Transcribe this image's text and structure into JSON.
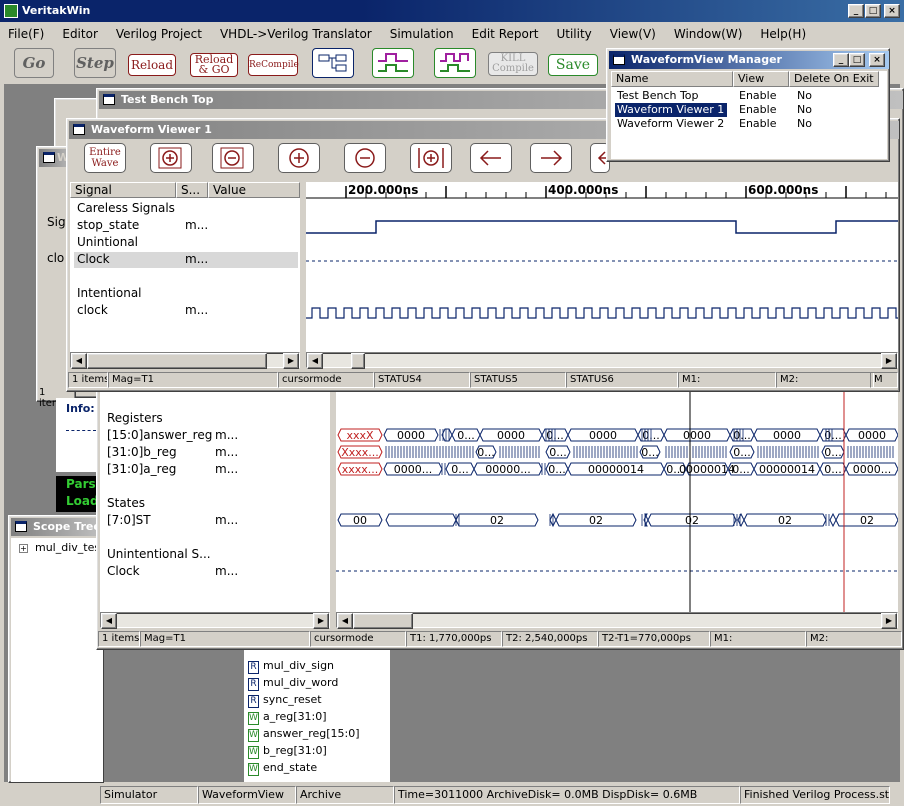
{
  "app": {
    "title": "VeritakWin",
    "menu": [
      "File(F)",
      "Editor",
      "Verilog Project",
      "VHDL->Verilog Translator",
      "Simulation",
      "Edit Report",
      "Utility",
      "View(V)",
      "Window(W)",
      "Help(H)"
    ],
    "toolbar": {
      "go": "Go",
      "step": "Step",
      "reload": "Reload",
      "reload_go": "Reload & GO",
      "recompile": "ReCompile",
      "kill": "KILL Compile",
      "save": "Save"
    }
  },
  "tbtop": {
    "title": "Test Bench Top"
  },
  "wv1": {
    "title": "Waveform Viewer 1",
    "entire_wave": "Entire Wave",
    "cols": [
      "Signal",
      "S...",
      "Value"
    ],
    "rows": [
      {
        "signal": "Careless Signals",
        "val": ""
      },
      {
        "signal": "stop_state",
        "val": "m..."
      },
      {
        "signal": "Unintional",
        "val": ""
      },
      {
        "signal": "Clock",
        "val": "m..."
      },
      {
        "signal": "",
        "val": ""
      },
      {
        "signal": "Intentional",
        "val": ""
      },
      {
        "signal": "clock",
        "val": "m..."
      }
    ],
    "ticks": [
      "200.000ns",
      "400.000ns",
      "600.000ns"
    ],
    "status": [
      "1 items.",
      "Mag=T1",
      "cursormode",
      "STATUS4",
      "STATUS5",
      "STATUS6",
      "M1:",
      "M2:",
      "M"
    ]
  },
  "wv2": {
    "rows": [
      {
        "signal": "Registers",
        "val": ""
      },
      {
        "signal": "[15:0]answer_reg",
        "val": "m..."
      },
      {
        "signal": "[31:0]b_reg",
        "val": "m..."
      },
      {
        "signal": "[31:0]a_reg",
        "val": "m..."
      },
      {
        "signal": "",
        "val": ""
      },
      {
        "signal": "States",
        "val": ""
      },
      {
        "signal": "[7:0]ST",
        "val": "m..."
      },
      {
        "signal": "",
        "val": ""
      },
      {
        "signal": "Unintentional S...",
        "val": ""
      },
      {
        "signal": "Clock",
        "val": "m..."
      }
    ],
    "answer_vals": [
      "xxxX",
      "0000",
      "0...",
      "0000",
      "0...",
      "0000",
      "0...",
      "0000",
      "0...",
      "0000",
      "0...",
      "0000"
    ],
    "b_vals": [
      "Xxxx...",
      "0...",
      "0...",
      "0...",
      "0...",
      "0..."
    ],
    "a_vals": [
      "xxxx...",
      "0000...",
      "0...",
      "00000...",
      "0...",
      "00000014",
      "0...",
      "00000014",
      "0...",
      "00000014",
      "0...",
      "0000..."
    ],
    "st_vals": [
      "00",
      "02",
      "02",
      "02",
      "02",
      "02",
      "02"
    ],
    "status": [
      "1 items.",
      "Mag=T1",
      "cursormode",
      "T1: 1,770,000ps",
      "T2: 2,540,000ps",
      "T2-T1=770,000ps",
      "M1:",
      "M2:"
    ]
  },
  "manager": {
    "title": "WaveformView Manager",
    "cols": [
      "Name",
      "View",
      "Delete On Exit"
    ],
    "rows": [
      {
        "name": "Test Bench Top",
        "view": "Enable",
        "del": "No"
      },
      {
        "name": "Waveform Viewer 1",
        "view": "Enable",
        "del": "No"
      },
      {
        "name": "Waveform Viewer 2",
        "view": "Enable",
        "del": "No"
      }
    ]
  },
  "scope": {
    "title": "Scope Tree",
    "item": "mul_div_test"
  },
  "signals": [
    {
      "t": "R",
      "name": "mul_div_sign"
    },
    {
      "t": "R",
      "name": "mul_div_word"
    },
    {
      "t": "R",
      "name": "sync_reset"
    },
    {
      "t": "W",
      "name": "a_reg[31:0]"
    },
    {
      "t": "W",
      "name": "answer_reg[15:0]"
    },
    {
      "t": "W",
      "name": "b_reg[31:0]"
    },
    {
      "t": "W",
      "name": "end_state"
    }
  ],
  "back": {
    "sig": "Sig",
    "clo": "clo",
    "info": "Info:",
    "pars": "Pars",
    "load": "Load",
    "v": "W",
    "items": "1 items."
  },
  "mainstatus": [
    "Simulator",
    "WaveformView",
    "Archive",
    "Time=3011000 ArchiveDisk=  0.0MB DispDisk=  0.6MB",
    "Finished Verilog Process.stab"
  ]
}
